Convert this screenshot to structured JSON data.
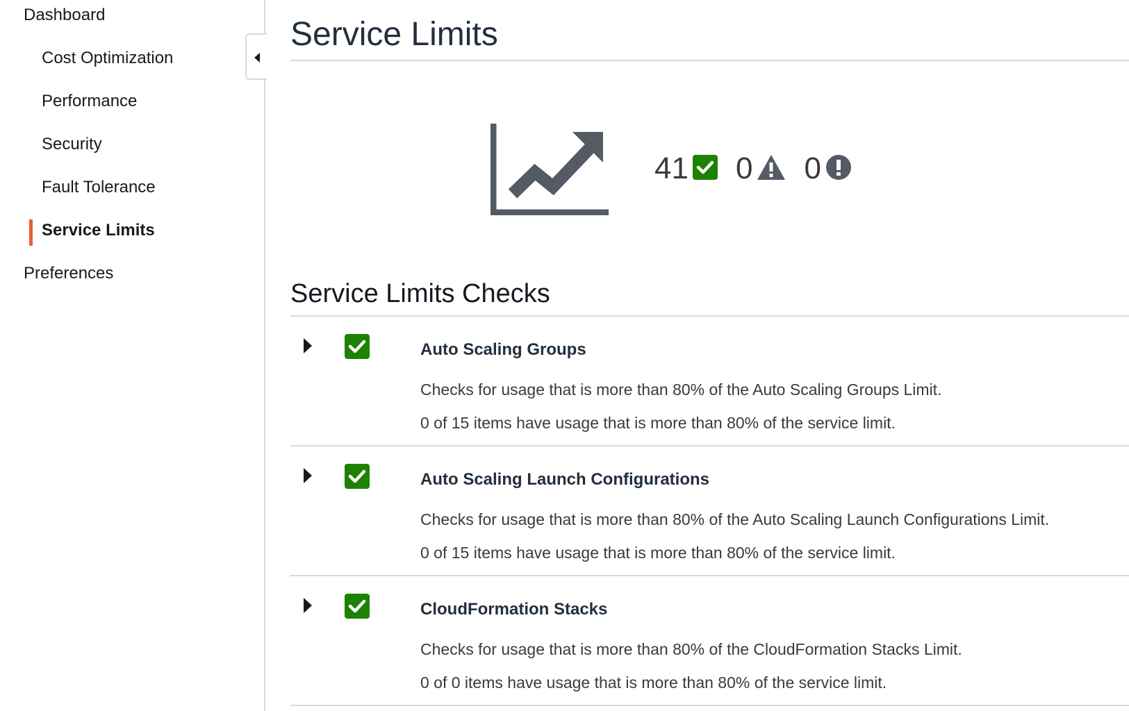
{
  "sidebar": {
    "items": [
      {
        "label": "Dashboard"
      },
      {
        "label": "Cost Optimization"
      },
      {
        "label": "Performance"
      },
      {
        "label": "Security"
      },
      {
        "label": "Fault Tolerance"
      },
      {
        "label": "Service Limits",
        "active": true
      },
      {
        "label": "Preferences"
      }
    ],
    "collapse_icon": "caret-left-icon"
  },
  "main": {
    "title": "Service Limits",
    "summary": {
      "chart_icon": "trending-up-chart-icon",
      "ok_count": "41",
      "ok_icon": "check-square-icon",
      "warning_count": "0",
      "warning_icon": "warning-triangle-icon",
      "error_count": "0",
      "error_icon": "exclamation-circle-icon"
    },
    "checks_title": "Service Limits Checks",
    "checks": [
      {
        "name": "Auto Scaling Groups",
        "description": "Checks for usage that is more than 80% of the Auto Scaling Groups Limit.",
        "status": "0 of 15 items have usage that is more than 80% of the service limit."
      },
      {
        "name": "Auto Scaling Launch Configurations",
        "description": "Checks for usage that is more than 80% of the Auto Scaling Launch Configurations Limit.",
        "status": "0 of 15 items have usage that is more than 80% of the service limit."
      },
      {
        "name": "CloudFormation Stacks",
        "description": "Checks for usage that is more than 80% of the CloudFormation Stacks Limit.",
        "status": "0 of 0 items have usage that is more than 80% of the service limit."
      }
    ]
  },
  "colors": {
    "ok_green": "#1d8102",
    "active_accent": "#ec5b2f",
    "icon_gray": "#545b64",
    "divider": "#d5dbdb"
  }
}
